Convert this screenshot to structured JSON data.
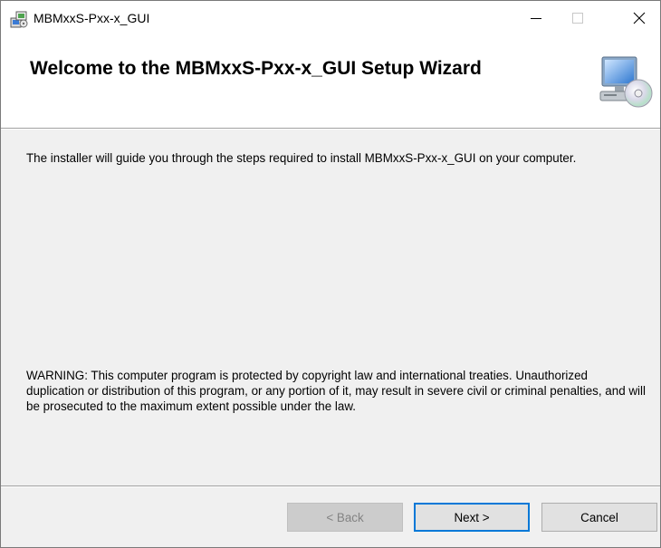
{
  "window": {
    "title": "MBMxxS-Pxx-x_GUI"
  },
  "banner": {
    "title": "Welcome to the MBMxxS-Pxx-x_GUI Setup Wizard"
  },
  "content": {
    "intro": "The installer will guide you through the steps required to install MBMxxS-Pxx-x_GUI on your computer.",
    "warning": "WARNING: This computer program is protected by copyright law and international treaties. Unauthorized duplication or distribution of this program, or any portion of it, may result in severe civil or criminal penalties, and will be prosecuted to the maximum extent possible under the law."
  },
  "buttons": {
    "back": "< Back",
    "next": "Next >",
    "cancel": "Cancel"
  },
  "icons": {
    "app": "installer-icon",
    "banner": "computer-cd-icon",
    "minimize": "minimize-icon",
    "maximize": "maximize-icon",
    "close": "close-icon"
  },
  "colors": {
    "accent": "#0078d7",
    "dialog_bg": "#f0f0f0",
    "banner_bg": "#ffffff",
    "disabled_text": "#838383"
  }
}
